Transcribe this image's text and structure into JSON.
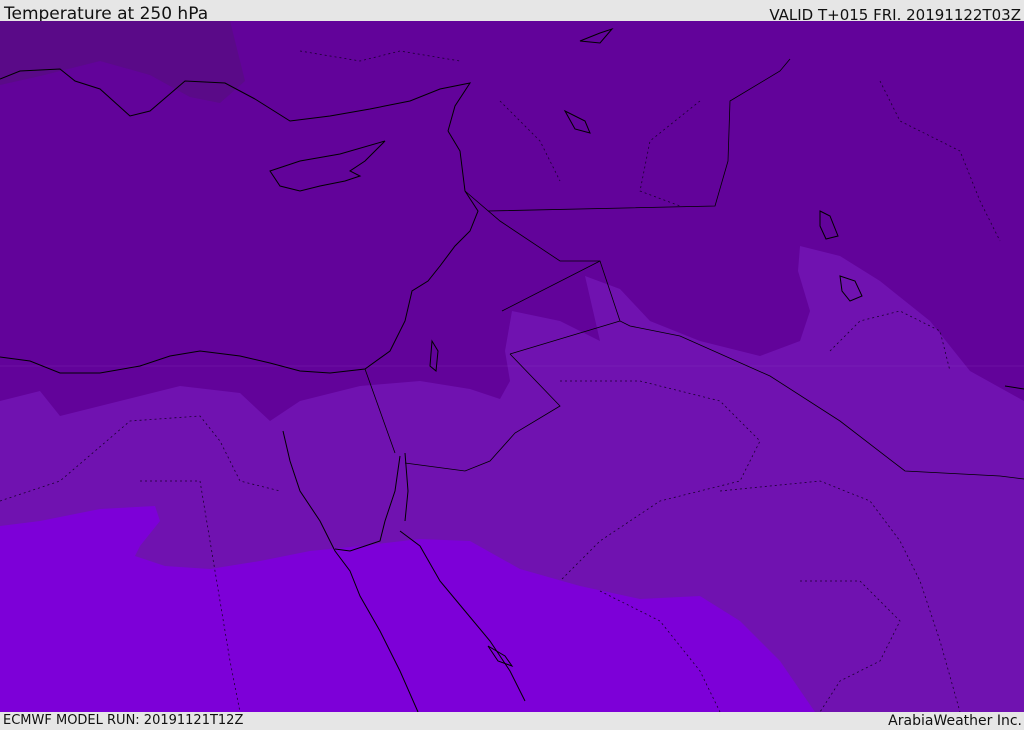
{
  "header": {
    "title": "Temperature at 250 hPa",
    "valid": "VALID T+015 FRI. 20191122T03Z"
  },
  "footer": {
    "model_run": "ECMWF MODEL RUN: 20191121T12Z",
    "credit": "ArabiaWeather Inc."
  },
  "map": {
    "colors": {
      "band_darkest": "#5a0a88",
      "band_dark": "#62039a",
      "band_mid": "#7012b0",
      "band_light": "#7d00d8",
      "coastline": "#000000"
    }
  }
}
